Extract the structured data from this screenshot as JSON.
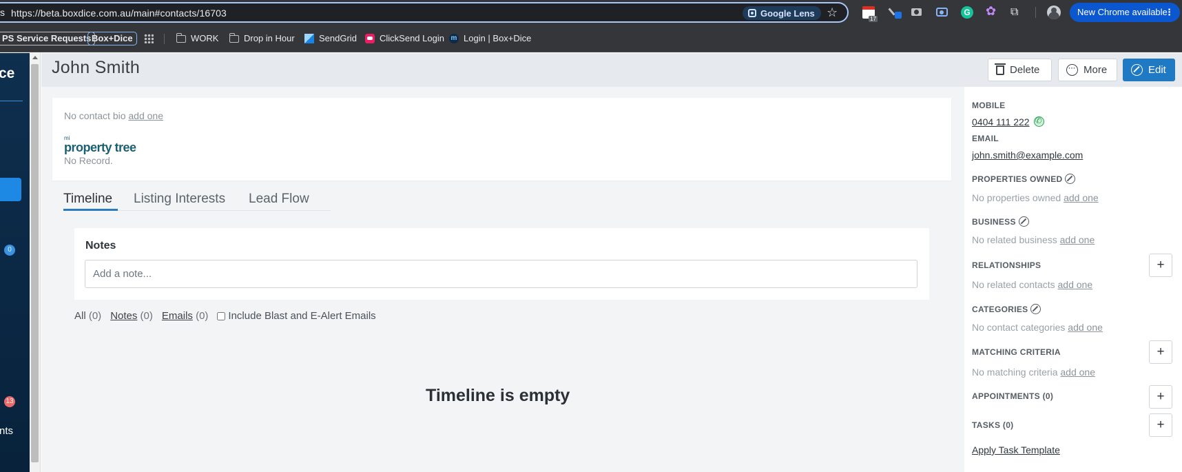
{
  "browser": {
    "url_fragment": "s",
    "url": "https://beta.boxdice.com.au/main#contacts/16703",
    "lens_label": "Google Lens",
    "calendar_badge": "17",
    "new_chrome_label": "New Chrome available",
    "grammarly_letter": "G"
  },
  "bookmarks": [
    {
      "label": "PS Service Requests"
    },
    {
      "label": "Box+Dice"
    },
    {
      "label": "WORK"
    },
    {
      "label": "Drop in Hour"
    },
    {
      "label": "SendGrid"
    },
    {
      "label": "ClickSend Login"
    },
    {
      "label": "Login | Box+Dice",
      "icon_letter": "m"
    }
  ],
  "leftnav": {
    "brand_fragment": "ce",
    "badge_blue": "0",
    "badge_red": "13",
    "item_fragment": "nts"
  },
  "header": {
    "title": "John Smith",
    "delete_label": "Delete",
    "more_label": "More",
    "edit_label": "Edit",
    "more_dots": "···"
  },
  "bio": {
    "no_bio": "No contact bio",
    "add_one": "add one",
    "pt_mi": "mi",
    "pt_name": "property tree",
    "no_record": "No Record."
  },
  "tabs": [
    "Timeline",
    "Listing Interests",
    "Lead Flow"
  ],
  "notes": {
    "title": "Notes",
    "placeholder": "Add a note..."
  },
  "filters": {
    "all_label": "All",
    "all_count": "(0)",
    "notes_label": "Notes",
    "notes_count": "(0)",
    "emails_label": "Emails",
    "emails_count": "(0)",
    "include_label": "Include Blast and E-Alert Emails"
  },
  "timeline_empty": "Timeline is empty",
  "sidebar": {
    "mobile_label": "MOBILE",
    "mobile_value": "0404 111 222",
    "email_label": "EMAIL",
    "email_value": "john.smith@example.com",
    "properties_label": "PROPERTIES OWNED",
    "properties_empty": "No properties owned",
    "business_label": "BUSINESS",
    "business_empty": "No related business",
    "relationships_label": "RELATIONSHIPS",
    "relationships_empty": "No related contacts",
    "categories_label": "CATEGORIES",
    "categories_empty": "No contact categories",
    "matching_label": "MATCHING CRITERIA",
    "matching_empty": "No matching criteria",
    "appointments_label": "APPOINTMENTS (0)",
    "tasks_label": "TASKS (0)",
    "apply_template": "Apply Task Template",
    "add_one": "add one",
    "plus": "+"
  }
}
